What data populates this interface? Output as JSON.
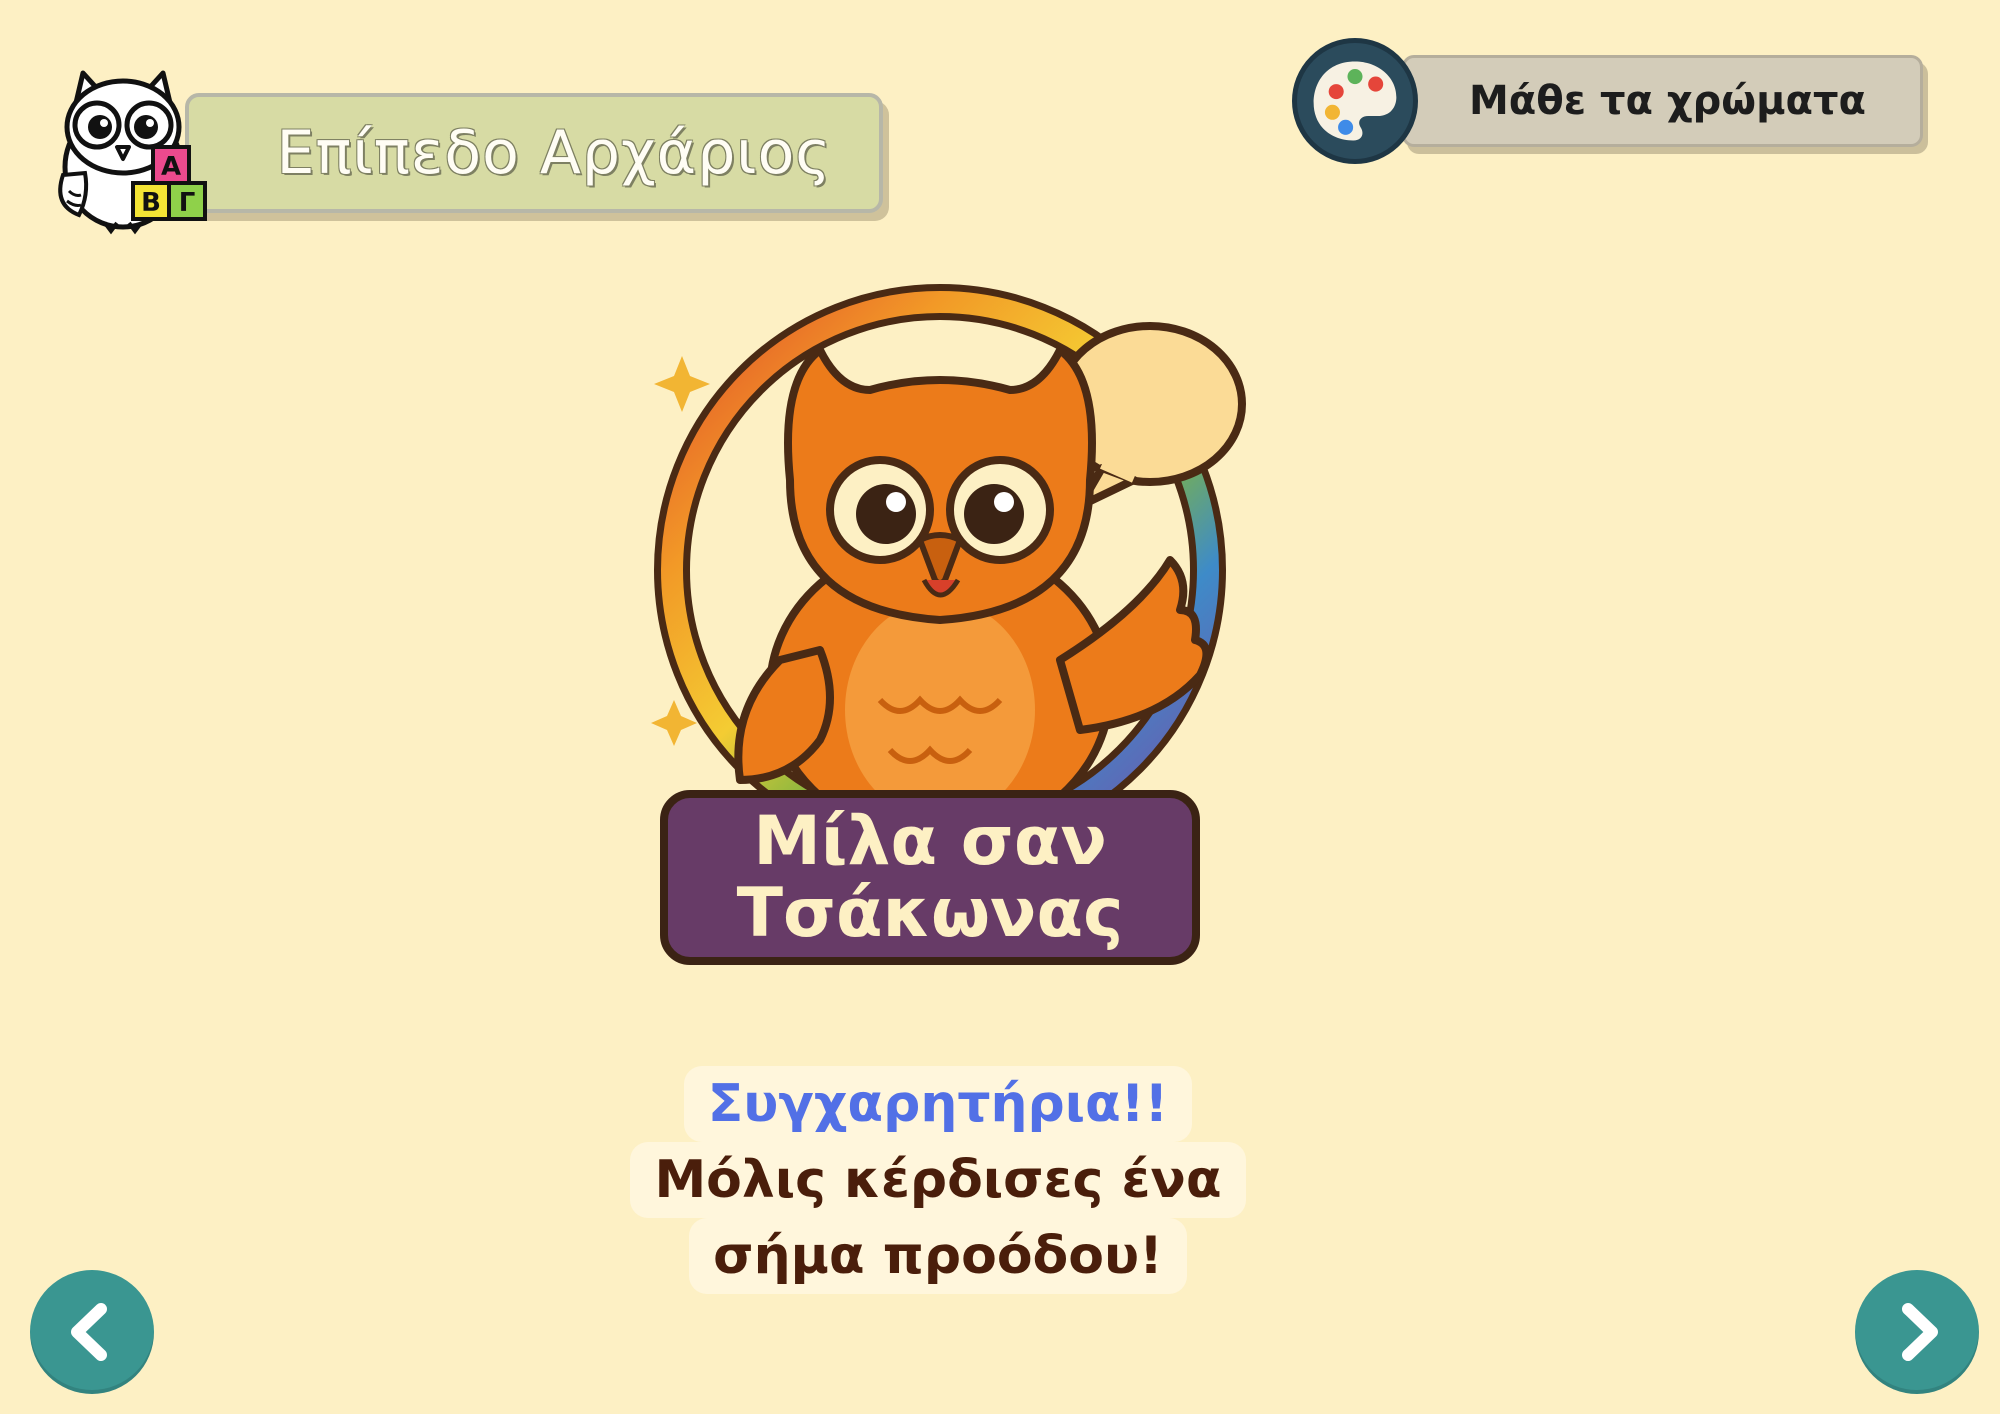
{
  "header": {
    "level_label": "Επίπεδο Αρχάριος",
    "mascot_blocks": [
      "Α",
      "Β",
      "Γ"
    ]
  },
  "colors_button": {
    "label": "Μάθε τα χρώματα"
  },
  "badge": {
    "title_line1": "Μίλα σαν",
    "title_line2": "Τσάκωνας"
  },
  "message": {
    "line1": "Συγχαρητήρια!!",
    "line2": "Μόλις κέρδισες ένα",
    "line3": "σήμα προόδου!"
  },
  "navigation": {
    "prev_icon": "chevron-left-icon",
    "next_icon": "chevron-right-icon"
  },
  "colors": {
    "background": "#fdf0c4",
    "nav_button": "#3a9691",
    "badge_plate": "#673b67",
    "owl_orange": "#ec7b1a",
    "congrats_blue": "#5270e6",
    "message_brown": "#4a1e0b"
  }
}
